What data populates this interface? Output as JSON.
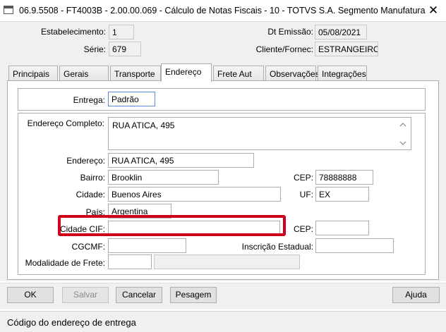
{
  "window": {
    "title": "06.9.5508 - FT4003B - 2.00.00.069 - Cálculo de Notas Fiscais - 10 - TOTVS S.A. Segmento Manufatura",
    "close_glyph": "✕"
  },
  "header": {
    "estabelecimento_label": "Estabelecimento:",
    "estabelecimento_value": "1",
    "serie_label": "Série:",
    "serie_value": "679",
    "dt_emissao_label": "Dt Emissão:",
    "dt_emissao_value": "05/08/2021",
    "cliente_label": "Cliente/Fornec:",
    "cliente_value": "ESTRANGEIRO"
  },
  "tabs": [
    {
      "label": "Principais"
    },
    {
      "label": "Gerais"
    },
    {
      "label": "Transporte"
    },
    {
      "label": "Endereço"
    },
    {
      "label": "Frete Aut"
    },
    {
      "label": "Observações"
    },
    {
      "label": "Integrações"
    }
  ],
  "endereco": {
    "entrega_label": "Entrega:",
    "entrega_value": "Padrão",
    "endereco_completo_label": "Endereço Completo:",
    "endereco_completo_value": "RUA ATICA, 495",
    "endereco_label": "Endereço:",
    "endereco_value": "RUA ATICA, 495",
    "bairro_label": "Bairro:",
    "bairro_value": "Brooklin",
    "cep_label": "CEP:",
    "cep_value": "78888888",
    "cidade_label": "Cidade:",
    "cidade_value": "Buenos Aires",
    "uf_label": "UF:",
    "uf_value": "EX",
    "pais_label": "País:",
    "pais_value": "Argentina",
    "cidade_cif_label": "Cidade CIF:",
    "cidade_cif_value": "",
    "cep_cif_label": "CEP:",
    "cep_cif_value": "",
    "cgcmf_label": "CGCMF:",
    "cgcmf_value": "",
    "inscricao_label": "Inscrição Estadual:",
    "inscricao_value": "",
    "modalidade_label": "Modalidade de Frete:",
    "modalidade_value": "",
    "modalidade_desc": "",
    "scroll_up_icon": "chevron-up",
    "scroll_down_icon": "chevron-down"
  },
  "buttons": {
    "ok": "OK",
    "salvar": "Salvar",
    "cancelar": "Cancelar",
    "pesagem": "Pesagem",
    "ajuda": "Ajuda"
  },
  "status": {
    "text": "Código do endereço de entrega"
  },
  "colors": {
    "highlight": "#d0021b"
  }
}
